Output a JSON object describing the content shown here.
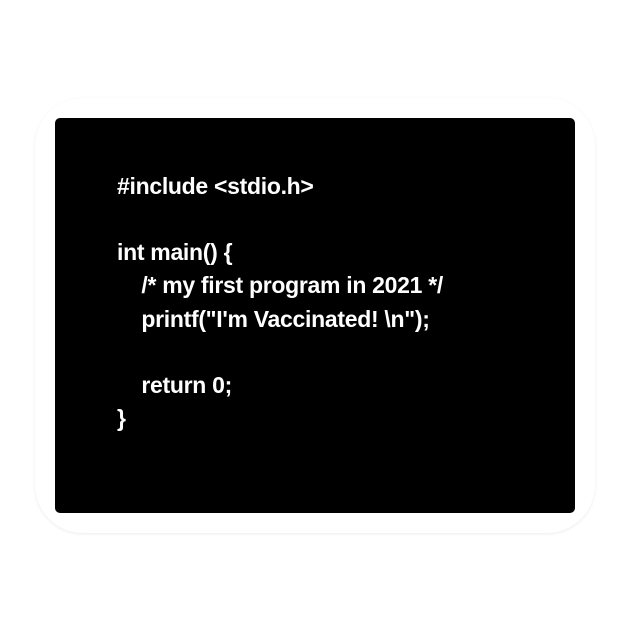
{
  "code": {
    "line1": "#include <stdio.h>",
    "line2": "int main() {",
    "line3": "    /* my first program in 2021 */",
    "line4": "    printf(\"I'm Vaccinated! \\n\");",
    "line5": "    return 0;",
    "line6": "}"
  }
}
